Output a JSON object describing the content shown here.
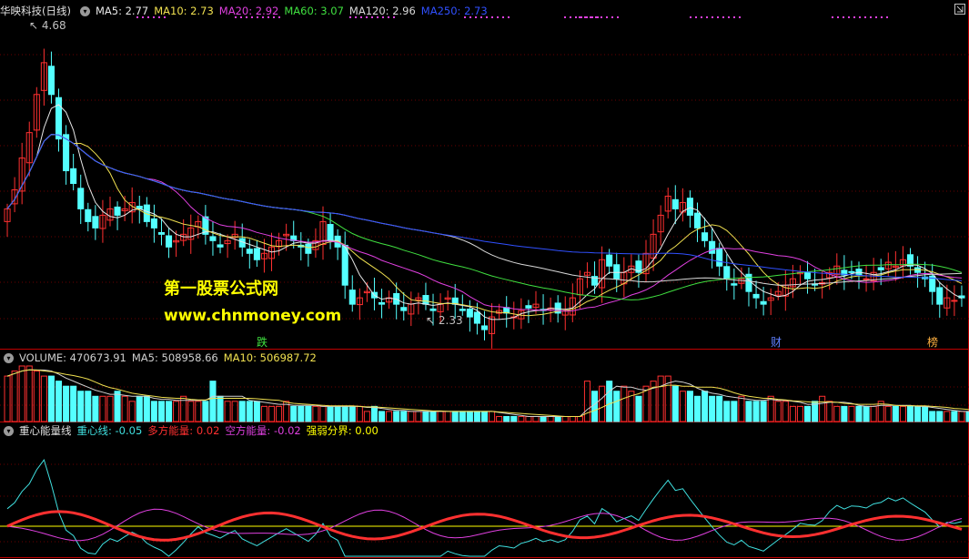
{
  "price_header": {
    "symbol": "华映科技(日线)",
    "items": [
      {
        "label": "MA5: 2.77",
        "color": "#e8e8e8"
      },
      {
        "label": "MA10: 2.73",
        "color": "#f0e050"
      },
      {
        "label": "MA20: 2.92",
        "color": "#e040e0"
      },
      {
        "label": "MA60: 3.07",
        "color": "#40e040"
      },
      {
        "label": "MA120: 2.96",
        "color": "#d8d8d8"
      },
      {
        "label": "MA250: 2.73",
        "color": "#3050ff"
      }
    ]
  },
  "volume_header": {
    "items": [
      {
        "label": "VOLUME: 470673.91",
        "color": "#d0d0d0"
      },
      {
        "label": "MA5: 508958.66",
        "color": "#d0d0d0"
      },
      {
        "label": "MA10: 506987.72",
        "color": "#f0e050"
      }
    ]
  },
  "indicator_header": {
    "name": "重心能量线",
    "items": [
      {
        "label": "重心线: -0.05",
        "color": "#40e0e0"
      },
      {
        "label": "多方能量: 0.02",
        "color": "#ff3030"
      },
      {
        "label": "空方能量: -0.02",
        "color": "#e040e0"
      },
      {
        "label": "强弱分界: 0.00",
        "color": "#ffff00"
      }
    ]
  },
  "annotations": {
    "high": "4.68",
    "low": "2.33"
  },
  "watermark": {
    "line1": "第一股票公式网",
    "line2": "www.chnmoney.com"
  },
  "markers": [
    {
      "text": "跌",
      "color": "#40e040"
    },
    {
      "text": "财",
      "color": "#6080ff"
    },
    {
      "text": "榜",
      "color": "#ffb040"
    }
  ],
  "colors": {
    "up": "#ff3030",
    "down": "#54ffff",
    "frame": "#c00000",
    "grid": "#6a0000",
    "background": "#000000"
  },
  "chart_data": [
    {
      "type": "candlestick",
      "title": "华映科技(日线)",
      "series": [
        "MA5",
        "MA10",
        "MA20",
        "MA60",
        "MA120",
        "MA250"
      ],
      "high_marker": 4.68,
      "low_marker": 2.33,
      "closes": [
        3.3,
        3.45,
        3.7,
        3.9,
        4.2,
        4.45,
        4.2,
        3.85,
        3.6,
        3.5,
        3.3,
        3.2,
        3.15,
        3.25,
        3.3,
        3.25,
        3.3,
        3.35,
        3.3,
        3.2,
        3.15,
        3.1,
        3.0,
        3.05,
        3.1,
        3.15,
        3.2,
        3.1,
        3.05,
        3.0,
        3.05,
        3.1,
        3.0,
        2.95,
        2.9,
        2.95,
        3.0,
        3.05,
        3.1,
        3.05,
        3.0,
        2.95,
        3.05,
        3.2,
        3.05,
        3.0,
        2.7,
        2.55,
        2.6,
        2.65,
        2.6,
        2.55,
        2.6,
        2.55,
        2.5,
        2.55,
        2.6,
        2.55,
        2.5,
        2.55,
        2.6,
        2.55,
        2.5,
        2.45,
        2.4,
        2.35,
        2.45,
        2.5,
        2.48,
        2.45,
        2.5,
        2.52,
        2.55,
        2.5,
        2.52,
        2.48,
        2.5,
        2.6,
        2.75,
        2.8,
        2.7,
        2.9,
        2.85,
        2.75,
        2.8,
        2.85,
        2.8,
        2.95,
        3.1,
        3.25,
        3.4,
        3.3,
        3.35,
        3.25,
        3.15,
        3.05,
        2.95,
        2.85,
        2.75,
        2.7,
        2.75,
        2.65,
        2.6,
        2.55,
        2.6,
        2.65,
        2.7,
        2.75,
        2.8,
        2.75,
        2.7,
        2.72,
        2.8,
        2.85,
        2.78,
        2.8,
        2.78,
        2.75,
        2.8,
        2.82,
        2.88,
        2.85,
        2.9,
        2.85,
        2.8,
        2.75,
        2.65,
        2.55,
        2.6,
        2.58,
        2.6
      ],
      "ylim": [
        2.2,
        4.8
      ]
    },
    {
      "type": "bar",
      "title": "VOLUME",
      "series": [
        "VOLUME",
        "MA5",
        "MA10"
      ],
      "values": [
        9,
        10,
        11,
        11,
        10,
        9,
        9,
        8,
        7,
        7,
        6,
        6,
        5,
        5,
        5,
        6,
        5,
        4,
        5,
        5,
        4,
        4,
        4,
        4,
        5,
        4,
        4,
        4,
        8,
        5,
        4,
        4,
        4,
        4,
        4,
        3,
        3,
        3,
        4,
        3,
        3,
        3,
        3,
        3,
        3,
        3,
        3,
        3,
        3,
        2,
        3,
        2,
        2,
        2,
        2,
        2,
        2,
        2,
        2,
        2,
        2,
        2,
        2,
        2,
        2,
        2,
        2,
        1,
        1,
        1,
        1,
        1,
        1,
        1,
        1,
        1,
        1,
        1,
        1,
        8,
        6,
        7,
        8,
        6,
        7,
        6,
        5,
        7,
        8,
        9,
        9,
        7,
        6,
        6,
        5,
        6,
        5,
        5,
        4,
        4,
        5,
        4,
        4,
        4,
        5,
        4,
        4,
        3,
        3,
        3,
        4,
        5,
        4,
        3,
        3,
        3,
        3,
        3,
        3,
        4,
        3,
        3,
        3,
        3,
        3,
        3,
        2,
        2,
        2,
        2,
        2,
        2
      ]
    },
    {
      "type": "line",
      "title": "重心能量线",
      "series": [
        "重心线",
        "多方能量",
        "空方能量",
        "强弱分界"
      ]
    }
  ]
}
